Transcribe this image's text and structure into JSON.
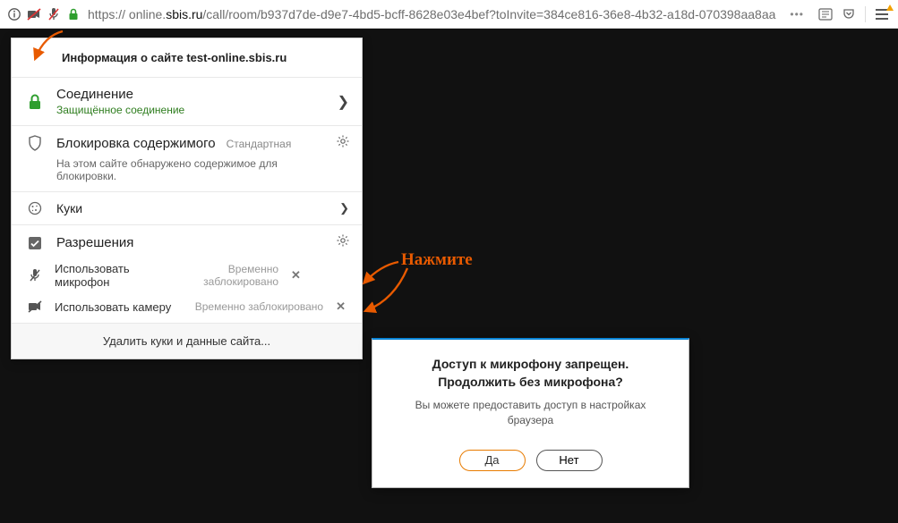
{
  "address_bar": {
    "scheme": "https://",
    "host_pre": " online.",
    "host": "sbis.ru",
    "path": "/call/room/b937d7de-d9e7-4bd5-bcff-8628e03e4bef?toInvite=384ce816-36e8-4b32-a18d-070398aa8aa",
    "ellipsis": "•••"
  },
  "panel": {
    "title": "Информация о сайте test-online.sbis.ru",
    "connection": {
      "title": "Соединение",
      "sub": "Защищённое соединение"
    },
    "blocking": {
      "title": "Блокировка содержимого",
      "badge": "Стандартная",
      "sub": "На этом сайте обнаружено содержимое для блокировки."
    },
    "cookies": {
      "title": "Куки"
    },
    "permissions": {
      "title": "Разрешения",
      "items": [
        {
          "icon": "mic",
          "label": "Использовать микрофон",
          "status": "Временно заблокировано"
        },
        {
          "icon": "cam",
          "label": "Использовать камеру",
          "status": "Временно заблокировано"
        }
      ]
    },
    "footer": "Удалить куки и данные сайта..."
  },
  "annotation": {
    "text": "Нажмите"
  },
  "dialog": {
    "title_l1": "Доступ к микрофону запрещен.",
    "title_l2": "Продолжить без микрофона?",
    "sub": "Вы можете предоставить доступ в настройках браузера",
    "yes": "Да",
    "no": "Нет"
  }
}
